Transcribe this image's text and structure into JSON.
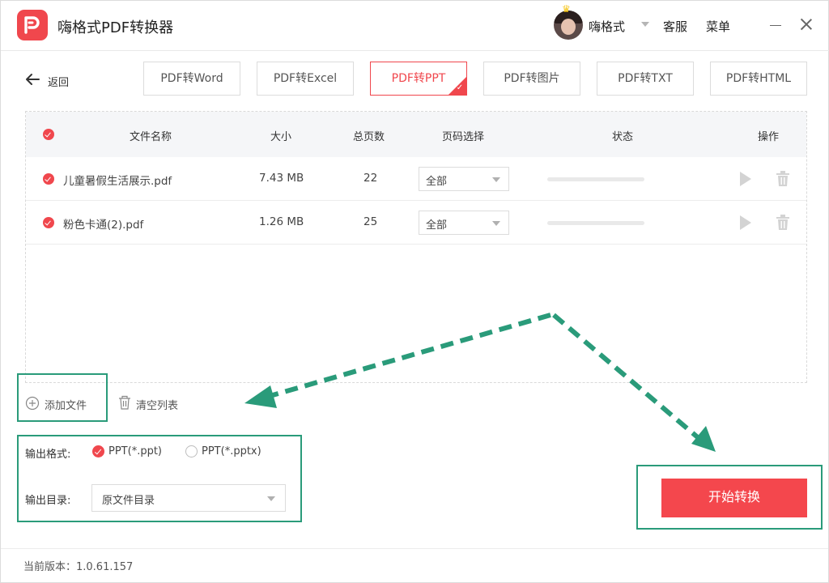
{
  "app": {
    "title": "嗨格式PDF转换器",
    "username": "嗨格式",
    "service_label": "客服",
    "menu_label": "菜单"
  },
  "nav": {
    "back_label": "返回"
  },
  "tabs": [
    {
      "label": "PDF转Word",
      "active": false
    },
    {
      "label": "PDF转Excel",
      "active": false
    },
    {
      "label": "PDF转PPT",
      "active": true
    },
    {
      "label": "PDF转图片",
      "active": false
    },
    {
      "label": "PDF转TXT",
      "active": false
    },
    {
      "label": "PDF转HTML",
      "active": false
    }
  ],
  "table": {
    "headers": {
      "name": "文件名称",
      "size": "大小",
      "pages": "总页数",
      "page_select": "页码选择",
      "status": "状态",
      "actions": "操作"
    },
    "rows": [
      {
        "name": "儿童暑假生活展示.pdf",
        "size": "7.43 MB",
        "pages": "22",
        "page_select": "全部",
        "progress": 0
      },
      {
        "name": "粉色卡通(2).pdf",
        "size": "1.26 MB",
        "pages": "25",
        "page_select": "全部",
        "progress": 0
      }
    ]
  },
  "actions": {
    "add_file": "添加文件",
    "clear_list": "清空列表"
  },
  "output": {
    "format_label": "输出格式:",
    "format_options": [
      {
        "label": "PPT(*.ppt)",
        "selected": true
      },
      {
        "label": "PPT(*.pptx)",
        "selected": false
      }
    ],
    "dir_label": "输出目录:",
    "dir_value": "原文件目录"
  },
  "start_button": "开始转换",
  "footer": {
    "version": "当前版本：1.0.61.157"
  },
  "icons": {
    "logo": "app-logo-icon",
    "back": "arrow-left-icon",
    "play": "play-icon",
    "trash": "trash-icon",
    "add": "plus-circle-icon",
    "clear": "trash-icon"
  },
  "colors": {
    "accent": "#f0474d",
    "annotation": "#2a9b7a"
  }
}
